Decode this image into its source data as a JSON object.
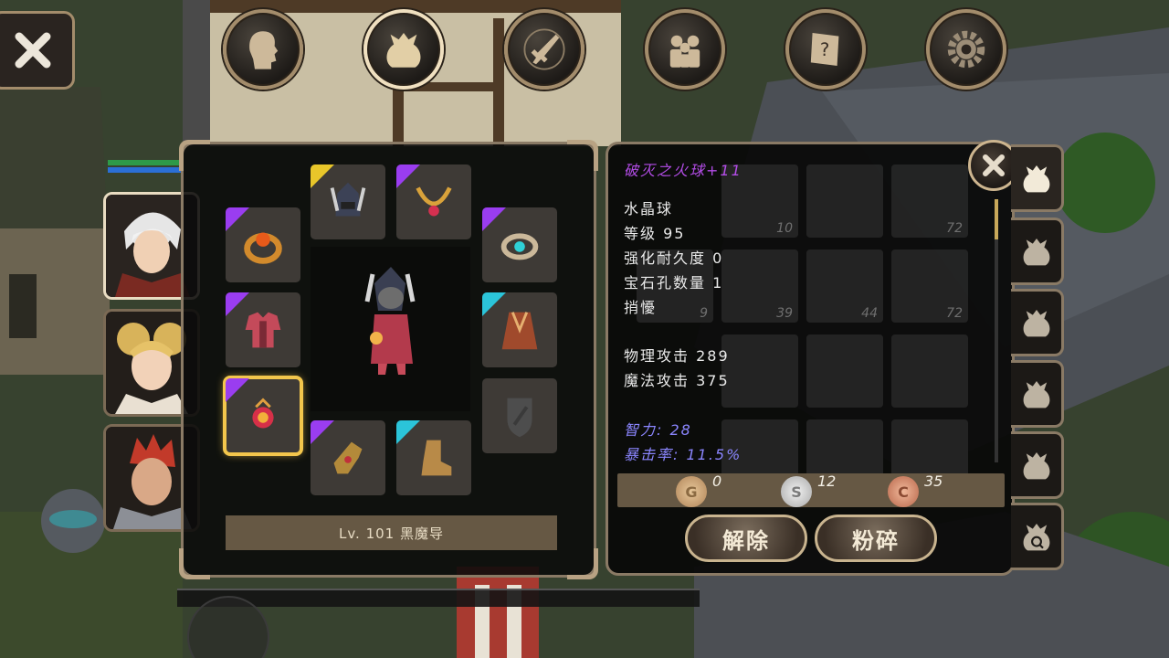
{
  "toolbar": {
    "close_icon": "close-icon",
    "tabs": [
      {
        "icon": "head-icon",
        "active": false
      },
      {
        "icon": "bag-icon",
        "active": true
      },
      {
        "icon": "sword-compass-icon",
        "active": false
      },
      {
        "icon": "party-icon",
        "active": false
      },
      {
        "icon": "scroll-quest-icon",
        "active": false
      },
      {
        "icon": "gear-icon",
        "active": false
      }
    ]
  },
  "party": {
    "members": [
      {
        "name": "white-hair-hero",
        "selected": true
      },
      {
        "name": "blonde-heroine",
        "selected": false
      },
      {
        "name": "red-hair-warrior",
        "selected": false
      }
    ]
  },
  "equipment": {
    "footer": "Lv. 101 黑魔导",
    "slots": [
      {
        "id": "helmet",
        "rarity": "yellow"
      },
      {
        "id": "necklace",
        "rarity": "purple"
      },
      {
        "id": "ring-left",
        "rarity": "purple"
      },
      {
        "id": "ring-right",
        "rarity": "purple"
      },
      {
        "id": "armor",
        "rarity": "purple"
      },
      {
        "id": "cloak",
        "rarity": "cyan"
      },
      {
        "id": "orb",
        "rarity": "purple"
      },
      {
        "id": "shield-empty",
        "rarity": "none"
      },
      {
        "id": "gloves",
        "rarity": "purple"
      },
      {
        "id": "boots",
        "rarity": "cyan"
      }
    ]
  },
  "item": {
    "name": "破灭之火球+11",
    "type": "水晶球",
    "level": "等级 95",
    "durability": "强化耐久度 0",
    "sockets": "宝石孔数量 1",
    "bound": "捎懮",
    "phys_atk": "物理攻击 289",
    "mag_atk": "魔法攻击 375",
    "int": "智力: 28",
    "crit": "暴击率: 11.5%"
  },
  "inventory_counts": [
    "10",
    "72",
    "9",
    "39",
    "44",
    "72"
  ],
  "money": {
    "gold": "0",
    "silver": "12",
    "copper": "35"
  },
  "buttons": {
    "unequip": "解除",
    "smash": "粉碎"
  },
  "colors": {
    "purple": "#9a3df0",
    "yellow": "#e8c62a",
    "cyan": "#2bc4d9",
    "panel_border": "#8a7a65"
  }
}
